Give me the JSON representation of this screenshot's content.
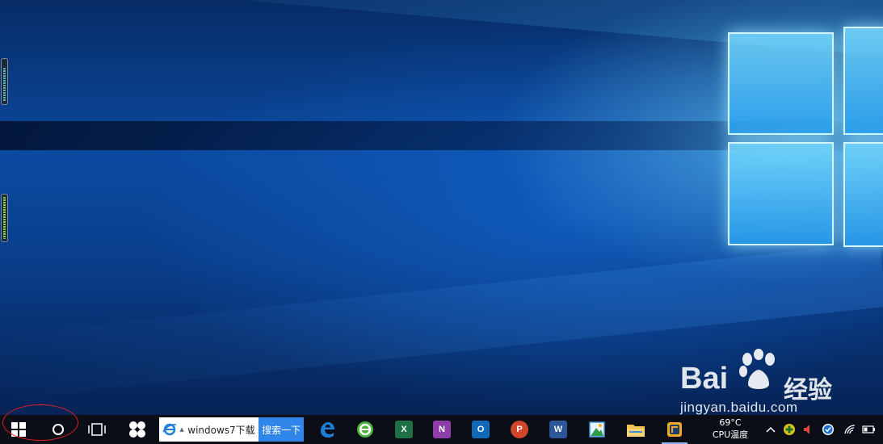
{
  "desktop": {
    "gadget_levels": [
      0.75,
      0.9
    ]
  },
  "watermark": {
    "brand_bai": "Bai",
    "brand_du": "du",
    "brand_jingyan": "经验",
    "url": "jingyan.baidu.com"
  },
  "taskbar": {
    "start_icon": "windows-logo-icon",
    "cortana_icon": "circle-icon",
    "task_view_icon": "task-view-icon",
    "pinned_fan_icon": "fan-icon",
    "search": {
      "engine_icon": "ie-icon",
      "value": "windows7下载",
      "button_label": "搜索一下"
    },
    "apps": [
      {
        "name": "edge",
        "icon": "edge-icon",
        "running": false
      },
      {
        "name": "browser-green",
        "icon": "green-e-browser-icon",
        "running": false
      },
      {
        "name": "excel",
        "icon": "excel-icon",
        "letter": "X",
        "color": "#1e7145",
        "running": false
      },
      {
        "name": "onenote",
        "icon": "onenote-icon",
        "letter": "N",
        "color": "#8e3ca8",
        "running": false
      },
      {
        "name": "outlook",
        "icon": "outlook-icon",
        "letter": "O",
        "color": "#0f6ab8",
        "running": false
      },
      {
        "name": "powerpoint",
        "icon": "powerpoint-icon",
        "letter": "P",
        "color": "#d0472a",
        "running": false
      },
      {
        "name": "word",
        "icon": "word-icon",
        "letter": "W",
        "color": "#2b5799",
        "running": false
      },
      {
        "name": "image-viewer",
        "icon": "photo-viewer-icon",
        "running": false
      },
      {
        "name": "file-explorer",
        "icon": "folder-icon",
        "running": false
      },
      {
        "name": "vmware",
        "icon": "vm-box-icon",
        "running": true
      }
    ],
    "cpu": {
      "temp": "69°C",
      "label": "CPU温度"
    },
    "tray": [
      "chevron-up-icon",
      "plus-shield-icon",
      "speaker-icon",
      "check-circle-icon",
      "wifi-icon",
      "battery-icon"
    ]
  },
  "colors": {
    "taskbar_bg": "#0b0e16",
    "search_button": "#2f86e8",
    "highlight_ellipse": "#e02020"
  }
}
